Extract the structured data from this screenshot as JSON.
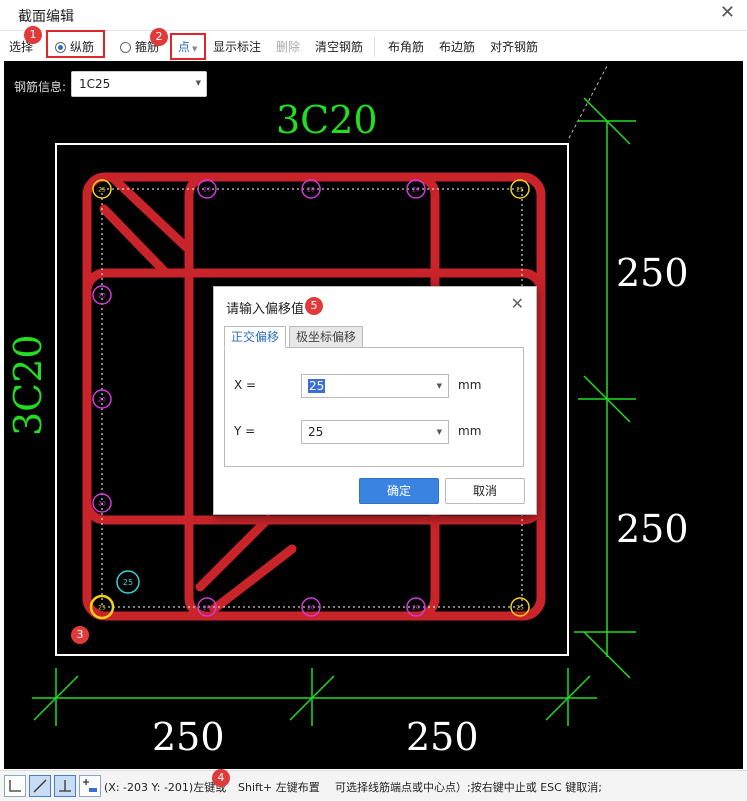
{
  "window": {
    "title": "截面编辑"
  },
  "toolbar": {
    "select_label": "选择",
    "longitudinal_label": "纵筋",
    "stirrup_label": "箍筋",
    "mode_label": "点",
    "show_annotation": "显示标注",
    "delete": "删除",
    "clear": "清空钢筋",
    "corner": "布角筋",
    "edge": "布边筋",
    "align": "对齐钢筋"
  },
  "rebar_info": {
    "label": "钢筋信息:",
    "value": "1C25"
  },
  "drawing": {
    "top_label": "3C20",
    "left_label": "3C20",
    "dims": {
      "right_top": "250",
      "right_bottom": "250",
      "bottom_left": "250",
      "bottom_right": "250"
    },
    "bar_tag_small": "20",
    "bar_tag_corner": "25",
    "bar_tag_cursor": "25",
    "colors": {
      "stirrup": "#c8242a",
      "dim": "#22dd22",
      "label": "#22dd22",
      "corner_bar": "#f2d21b",
      "edge_bar": "#d23ad9",
      "cursor": "#36d4d4",
      "section": "#ffffff"
    }
  },
  "dialog": {
    "title": "请输入偏移值",
    "tab_orthogonal": "正交偏移",
    "tab_polar": "极坐标偏移",
    "x_label": "X =",
    "x_value": "25",
    "y_label": "Y =",
    "y_value": "25",
    "unit": "mm",
    "ok": "确定",
    "cancel": "取消"
  },
  "status": {
    "coords_text": "(X: -203 Y: -201)左键或",
    "shift_text": "Shift+ 左键布置",
    "hint_text": "可选择线筋端点或中心点）;按右键中止或 ESC 键取消;"
  },
  "badges": [
    "1",
    "2",
    "3",
    "4",
    "5"
  ]
}
